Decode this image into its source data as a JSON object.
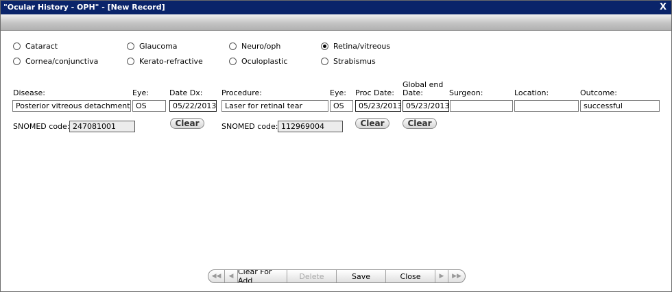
{
  "window": {
    "title": "\"Ocular History - OPH\" - [New Record]",
    "close_glyph": "X"
  },
  "categories": [
    {
      "label": "Cataract",
      "checked": false
    },
    {
      "label": "Glaucoma",
      "checked": false
    },
    {
      "label": "Neuro/oph",
      "checked": false
    },
    {
      "label": "Retina/vitreous",
      "checked": true
    },
    {
      "label": "Cornea/conjunctiva",
      "checked": false
    },
    {
      "label": "Kerato-refractive",
      "checked": false
    },
    {
      "label": "Oculoplastic",
      "checked": false
    },
    {
      "label": "Strabismus",
      "checked": false
    }
  ],
  "labels": {
    "disease": "Disease:",
    "eye": "Eye:",
    "date_dx": "Date Dx:",
    "procedure": "Procedure:",
    "proc_eye": "Eye:",
    "proc_date": "Proc Date:",
    "global_end_date_1": "Global end",
    "global_end_date_2": "Date:",
    "surgeon": "Surgeon:",
    "location": "Location:",
    "outcome": "Outcome:",
    "snomed_disease": "SNOMED code:",
    "snomed_procedure": "SNOMED code:"
  },
  "values": {
    "disease": "Posterior vitreous detachment",
    "eye": "OS",
    "date_dx": "05/22/2013",
    "procedure": "Laser for retinal tear",
    "proc_eye": "OS",
    "proc_date": "05/23/2013",
    "global_end_date": "05/23/2013",
    "surgeon": "",
    "location": "",
    "outcome": "successful",
    "snomed_disease": "247081001",
    "snomed_procedure": "112969004"
  },
  "buttons": {
    "clear": "Clear"
  },
  "navbar": {
    "first": "◀◀",
    "prev": "◀",
    "clear_for_add": "Clear For Add",
    "delete": "Delete",
    "save": "Save",
    "close": "Close",
    "next": "▶",
    "last": "▶▶"
  }
}
